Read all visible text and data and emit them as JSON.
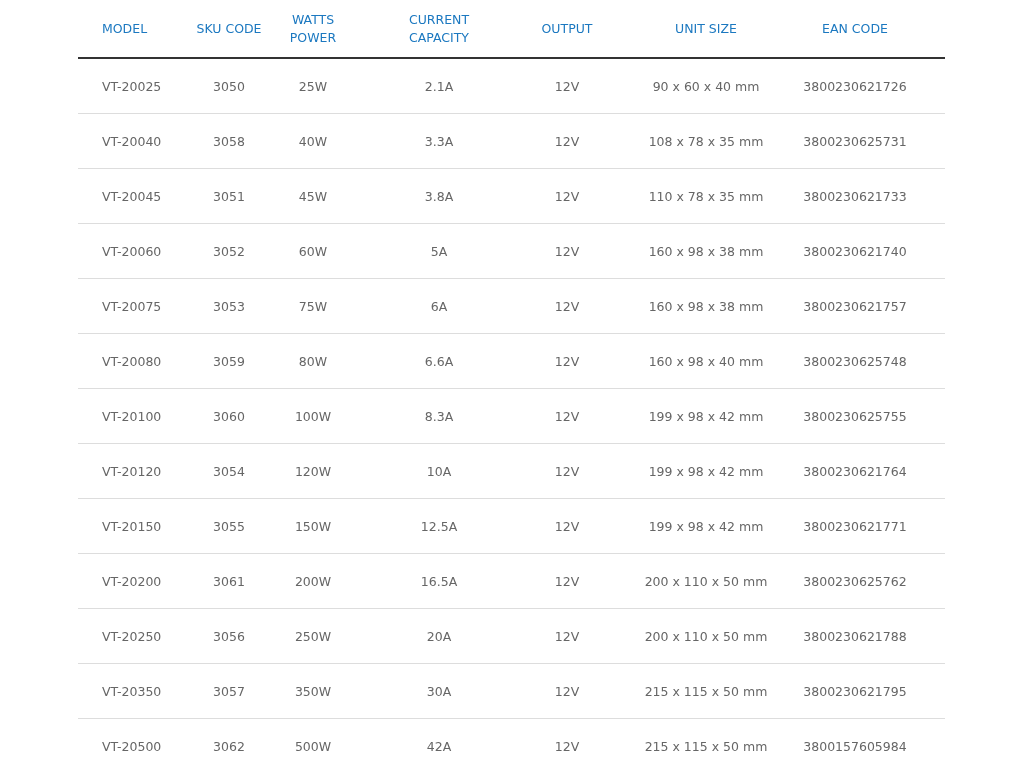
{
  "table": {
    "columns": [
      "MODEL",
      "SKU CODE",
      "WATTS\nPOWER",
      "CURRENT\nCAPACITY",
      "OUTPUT",
      "UNIT SIZE",
      "EAN CODE"
    ],
    "rows": [
      [
        "VT-20025",
        "3050",
        "25W",
        "2.1A",
        "12V",
        "90 x 60 x 40 mm",
        "3800230621726"
      ],
      [
        "VT-20040",
        "3058",
        "40W",
        "3.3A",
        "12V",
        "108 x 78 x 35 mm",
        "3800230625731"
      ],
      [
        "VT-20045",
        "3051",
        "45W",
        "3.8A",
        "12V",
        "110 x 78 x 35 mm",
        "3800230621733"
      ],
      [
        "VT-20060",
        "3052",
        "60W",
        "5A",
        "12V",
        "160 x 98 x 38 mm",
        "3800230621740"
      ],
      [
        "VT-20075",
        "3053",
        "75W",
        "6A",
        "12V",
        "160 x 98 x 38 mm",
        "3800230621757"
      ],
      [
        "VT-20080",
        "3059",
        "80W",
        "6.6A",
        "12V",
        "160 x 98 x 40 mm",
        "3800230625748"
      ],
      [
        "VT-20100",
        "3060",
        "100W",
        "8.3A",
        "12V",
        "199 x 98 x 42 mm",
        "3800230625755"
      ],
      [
        "VT-20120",
        "3054",
        "120W",
        "10A",
        "12V",
        "199 x 98 x 42 mm",
        "3800230621764"
      ],
      [
        "VT-20150",
        "3055",
        "150W",
        "12.5A",
        "12V",
        "199 x 98 x 42 mm",
        "3800230621771"
      ],
      [
        "VT-20200",
        "3061",
        "200W",
        "16.5A",
        "12V",
        "200 x 110 x 50 mm",
        "3800230625762"
      ],
      [
        "VT-20250",
        "3056",
        "250W",
        "20A",
        "12V",
        "200 x 110 x 50 mm",
        "3800230621788"
      ],
      [
        "VT-20350",
        "3057",
        "350W",
        "30A",
        "12V",
        "215 x 115 x 50 mm",
        "3800230621795"
      ],
      [
        "VT-20500",
        "3062",
        "500W",
        "42A",
        "12V",
        "215 x 115 x 50 mm",
        "3800157605984"
      ]
    ]
  }
}
